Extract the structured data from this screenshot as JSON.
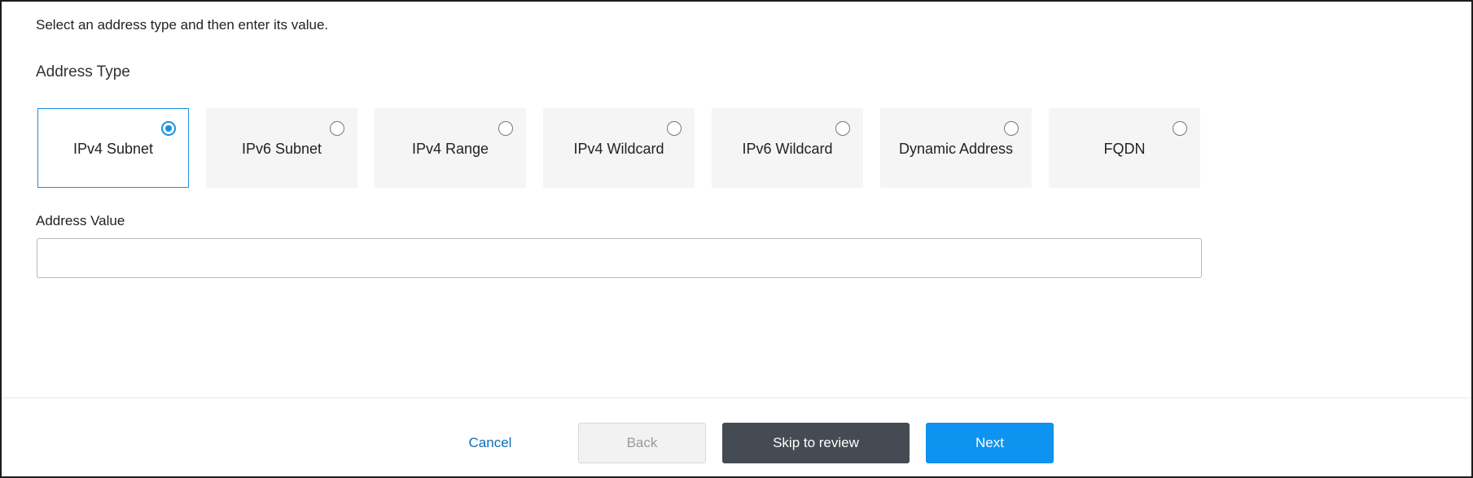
{
  "instruction": "Select an address type and then enter its value.",
  "address_type": {
    "label": "Address Type",
    "selected": "IPv4 Subnet",
    "options": [
      {
        "label": "IPv4 Subnet",
        "selected": true
      },
      {
        "label": "IPv6 Subnet",
        "selected": false
      },
      {
        "label": "IPv4 Range",
        "selected": false
      },
      {
        "label": "IPv4 Wildcard",
        "selected": false
      },
      {
        "label": "IPv6 Wildcard",
        "selected": false
      },
      {
        "label": "Dynamic Address",
        "selected": false
      },
      {
        "label": "FQDN",
        "selected": false
      }
    ]
  },
  "address_value": {
    "label": "Address Value",
    "value": "",
    "placeholder": ""
  },
  "footer": {
    "cancel_label": "Cancel",
    "back_label": "Back",
    "skip_label": "Skip to review",
    "next_label": "Next"
  },
  "colors": {
    "accent": "#1b8fdc",
    "primary_button": "#0e93f0",
    "secondary_button": "#454b52",
    "link": "#0a6fb8"
  }
}
